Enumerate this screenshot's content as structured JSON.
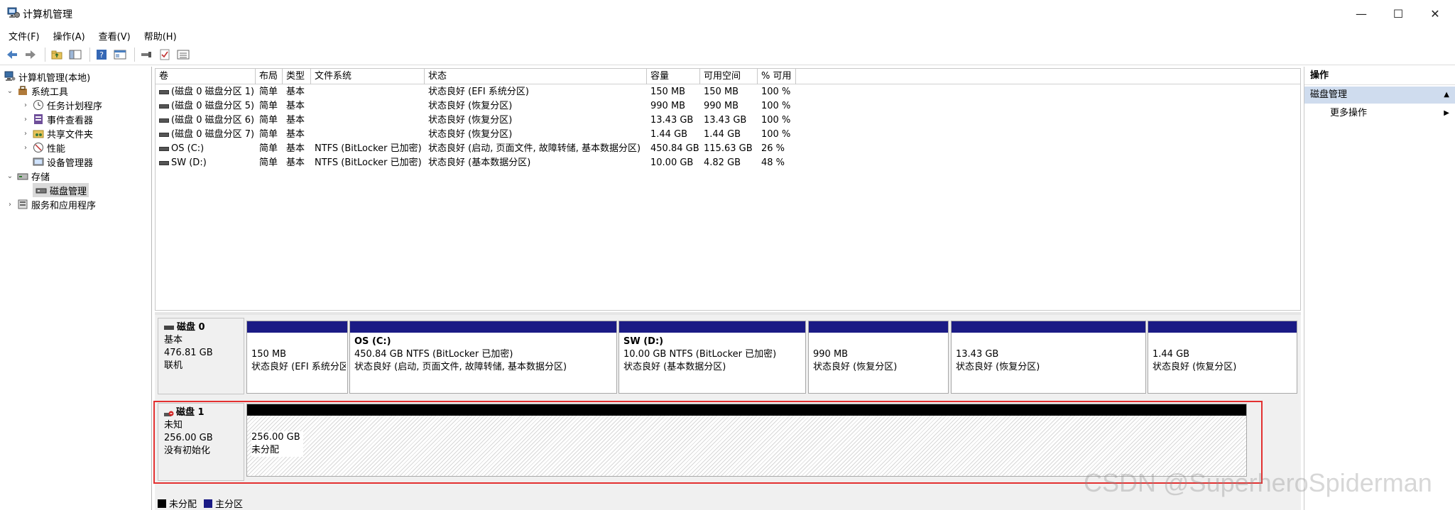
{
  "window": {
    "title": "计算机管理",
    "minimize": "—",
    "maximize": "☐",
    "close": "✕"
  },
  "menu": [
    "文件(F)",
    "操作(A)",
    "查看(V)",
    "帮助(H)"
  ],
  "toolbar": [
    "back-arrow-icon",
    "forward-arrow-icon",
    "up-folder-icon",
    "show-hide-tree-icon",
    "help-icon",
    "properties-icon",
    "connect-icon",
    "check-icon",
    "list-icon"
  ],
  "tree": {
    "root": "计算机管理(本地)",
    "system_tools": "系统工具",
    "task_scheduler": "任务计划程序",
    "event_viewer": "事件查看器",
    "shared_folders": "共享文件夹",
    "performance": "性能",
    "device_manager": "设备管理器",
    "storage": "存储",
    "disk_management": "磁盘管理",
    "services_apps": "服务和应用程序"
  },
  "volumes": {
    "columns": [
      "卷",
      "布局",
      "类型",
      "文件系统",
      "状态",
      "容量",
      "可用空间",
      "% 可用"
    ],
    "rows": [
      [
        "(磁盘 0 磁盘分区 1)",
        "简单",
        "基本",
        "",
        "状态良好 (EFI 系统分区)",
        "150 MB",
        "150 MB",
        "100 %"
      ],
      [
        "(磁盘 0 磁盘分区 5)",
        "简单",
        "基本",
        "",
        "状态良好 (恢复分区)",
        "990 MB",
        "990 MB",
        "100 %"
      ],
      [
        "(磁盘 0 磁盘分区 6)",
        "简单",
        "基本",
        "",
        "状态良好 (恢复分区)",
        "13.43 GB",
        "13.43 GB",
        "100 %"
      ],
      [
        "(磁盘 0 磁盘分区 7)",
        "简单",
        "基本",
        "",
        "状态良好 (恢复分区)",
        "1.44 GB",
        "1.44 GB",
        "100 %"
      ],
      [
        "OS (C:)",
        "简单",
        "基本",
        "NTFS (BitLocker 已加密)",
        "状态良好 (启动, 页面文件, 故障转储, 基本数据分区)",
        "450.84 GB",
        "115.63 GB",
        "26 %"
      ],
      [
        "SW (D:)",
        "简单",
        "基本",
        "NTFS (BitLocker 已加密)",
        "状态良好 (基本数据分区)",
        "10.00 GB",
        "4.82 GB",
        "48 %"
      ]
    ]
  },
  "disk0": {
    "name": "磁盘 0",
    "type": "基本",
    "size": "476.81 GB",
    "status": "联机",
    "partitions": [
      {
        "title": "",
        "size": "150 MB",
        "status": "状态良好 (EFI 系统分区)"
      },
      {
        "title": "OS  (C:)",
        "size": "450.84 GB NTFS (BitLocker 已加密)",
        "status": "状态良好 (启动, 页面文件, 故障转储, 基本数据分区)"
      },
      {
        "title": "SW  (D:)",
        "size": "10.00 GB NTFS (BitLocker 已加密)",
        "status": "状态良好 (基本数据分区)"
      },
      {
        "title": "",
        "size": "990 MB",
        "status": "状态良好 (恢复分区)"
      },
      {
        "title": "",
        "size": "13.43 GB",
        "status": "状态良好 (恢复分区)"
      },
      {
        "title": "",
        "size": "1.44 GB",
        "status": "状态良好 (恢复分区)"
      }
    ]
  },
  "disk1": {
    "name": "磁盘 1",
    "type": "未知",
    "size": "256.00 GB",
    "status": "没有初始化",
    "unalloc_size": "256.00 GB",
    "unalloc_label": "未分配"
  },
  "legend": {
    "unallocated": "未分配",
    "primary": "主分区"
  },
  "actions": {
    "title": "操作",
    "section": "磁盘管理",
    "more": "更多操作"
  },
  "watermark": "CSDN @SuperheroSpiderman",
  "colors": {
    "primary_partition": "#1b1b85",
    "unallocated": "#000000",
    "highlight": "#e33030",
    "action_section": "#cfdcee"
  }
}
